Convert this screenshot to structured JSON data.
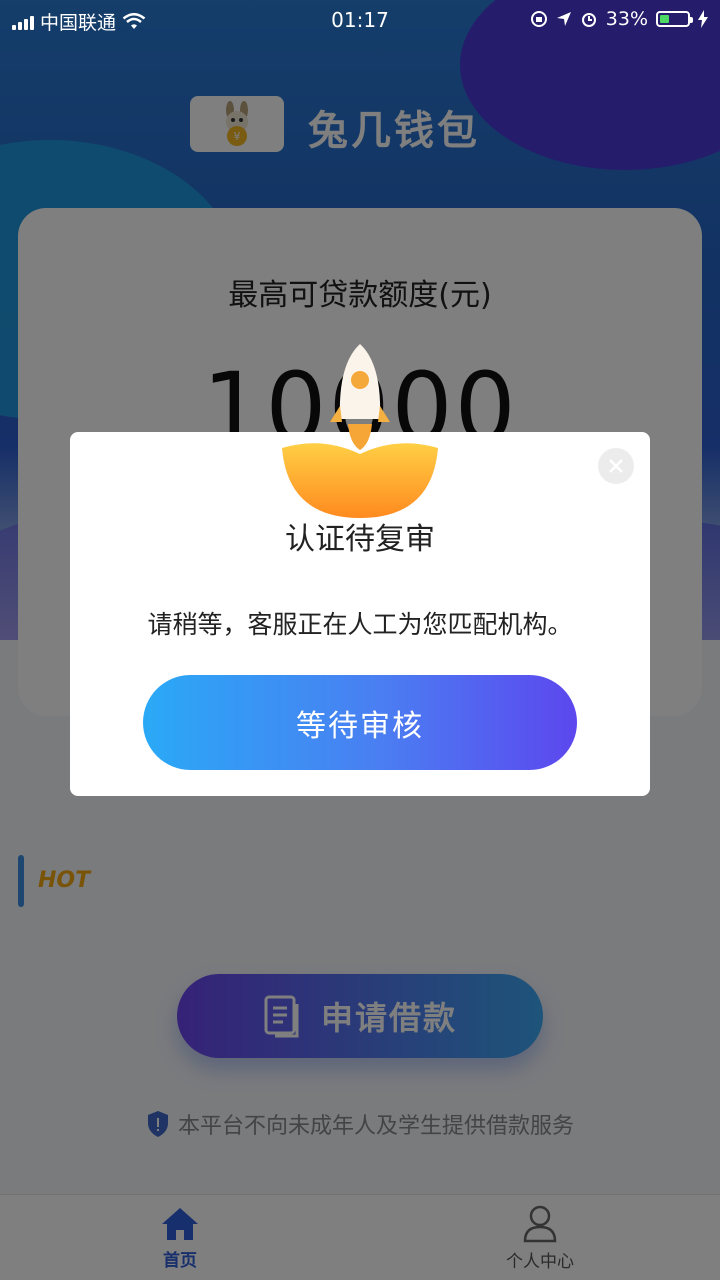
{
  "status_bar": {
    "carrier": "中国联通",
    "time": "01:17",
    "battery": "33%",
    "battery_level": 0.33
  },
  "header": {
    "app_title": "兔几钱包"
  },
  "card": {
    "label": "最高可贷款额度(元)",
    "amount": "10000"
  },
  "section": {
    "hot": "HOT"
  },
  "apply_button": {
    "label": "申请借款"
  },
  "notice": {
    "text": "本平台不向未成年人及学生提供借款服务"
  },
  "tabbar": {
    "home": "首页",
    "profile": "个人中心"
  },
  "modal": {
    "title": "认证待复审",
    "message": "请稍等，客服正在人工为您匹配机构。",
    "button": "等待审核"
  },
  "colors": {
    "accent": "#2f5fd8",
    "hot": "#f2a80c",
    "gradient_start": "#2aa9f6",
    "gradient_end": "#5c47ee"
  }
}
